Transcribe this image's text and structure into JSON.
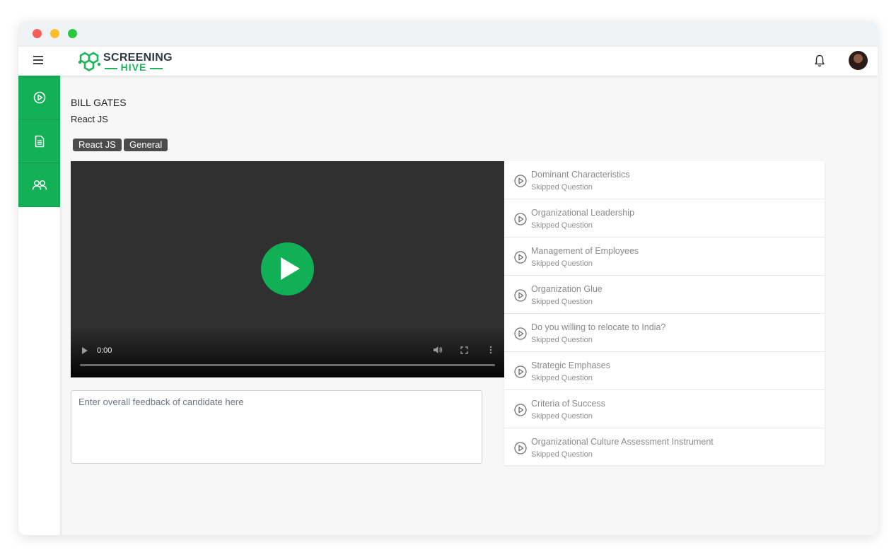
{
  "window": {
    "controls": [
      "close",
      "minimize",
      "maximize"
    ]
  },
  "appbar": {
    "menu_icon": "hamburger-icon",
    "logo": {
      "top": "SCREENING",
      "bottom": "HIVE"
    },
    "bell_icon": "bell-icon",
    "avatar_icon": "user-avatar"
  },
  "sidebar": {
    "items": [
      {
        "icon": "play-circle-icon"
      },
      {
        "icon": "document-icon"
      },
      {
        "icon": "users-icon"
      }
    ]
  },
  "candidate": {
    "name": "BILL GATES",
    "role": "React JS",
    "tags": [
      "React JS",
      "General"
    ]
  },
  "video": {
    "time": "0:00",
    "progress": 0
  },
  "feedback": {
    "placeholder": "Enter overall feedback of candidate here"
  },
  "questions": [
    {
      "title": "Dominant Characteristics",
      "status": "Skipped Question"
    },
    {
      "title": "Organizational Leadership",
      "status": "Skipped Question"
    },
    {
      "title": "Management of Employees",
      "status": "Skipped Question"
    },
    {
      "title": "Organization Glue",
      "status": "Skipped Question"
    },
    {
      "title": "Do you willing to relocate to India?",
      "status": "Skipped Question"
    },
    {
      "title": "Strategic Emphases",
      "status": "Skipped Question"
    },
    {
      "title": "Criteria of Success",
      "status": "Skipped Question"
    },
    {
      "title": "Organizational Culture Assessment Instrument",
      "status": "Skipped Question"
    }
  ],
  "colors": {
    "brand_green": "#14b057",
    "video_bg": "#303030",
    "tag_bg": "#4b4b4b"
  }
}
